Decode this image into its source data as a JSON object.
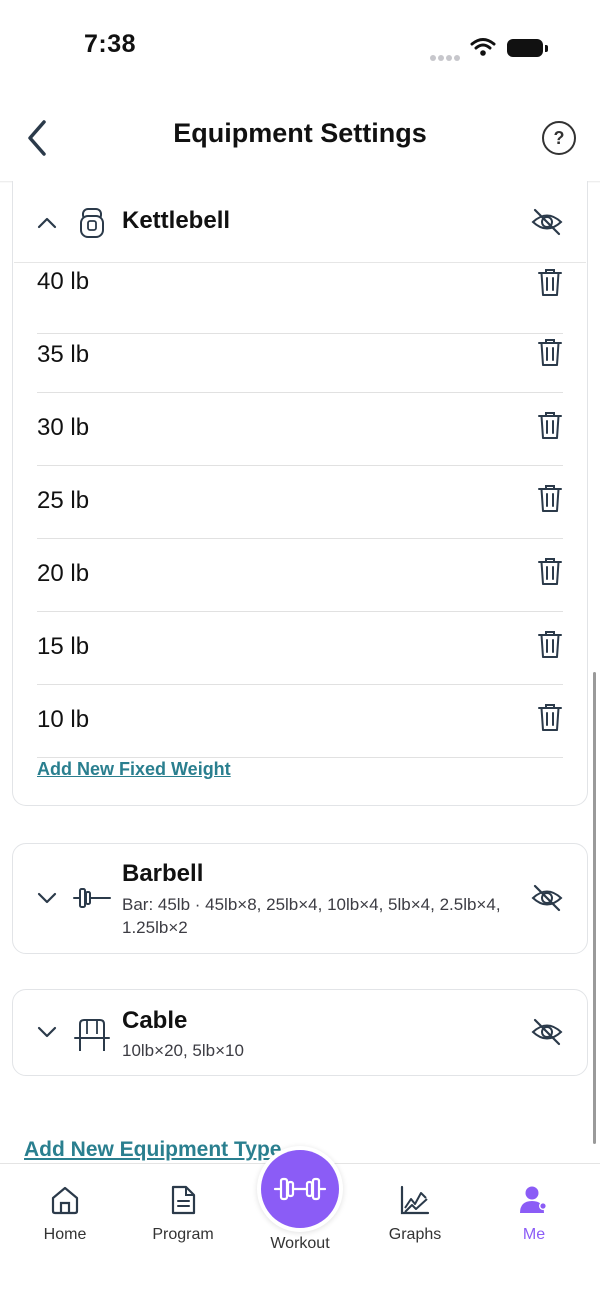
{
  "status_bar": {
    "time": "7:38"
  },
  "header": {
    "title": "Equipment Settings",
    "help_label": "?"
  },
  "kettlebell": {
    "name": "Kettlebell",
    "weights": [
      "40 lb",
      "35 lb",
      "30 lb",
      "25 lb",
      "20 lb",
      "15 lb",
      "10 lb"
    ],
    "add_weight_label": "Add New Fixed Weight"
  },
  "barbell": {
    "name": "Barbell",
    "summary": "Bar: 45lb · 45lb×8, 25lb×4, 10lb×4, 5lb×4, 2.5lb×4, 1.25lb×2"
  },
  "cable": {
    "name": "Cable",
    "summary": "10lb×20, 5lb×10"
  },
  "add_equipment_type_label": "Add New Equipment Type",
  "tabs": {
    "home": "Home",
    "program": "Program",
    "workout": "Workout",
    "graphs": "Graphs",
    "me": "Me"
  },
  "colors": {
    "accent": "#8b5cf6",
    "link": "#2a7f8f"
  }
}
